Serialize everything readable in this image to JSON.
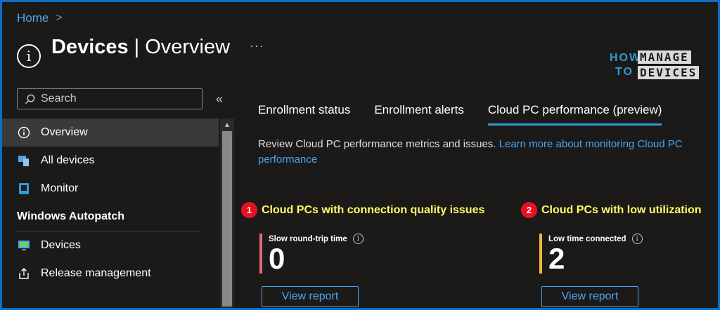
{
  "breadcrumb": {
    "home": "Home",
    "chevron": ">"
  },
  "header": {
    "title": "Devices",
    "separator": "|",
    "subtitle": "Overview",
    "more": "···",
    "icon": "info-circle-icon"
  },
  "logo": {
    "how": "HOW",
    "to": "TO",
    "manage": "MANAGE",
    "devices": "DEVICES"
  },
  "search": {
    "placeholder": "Search",
    "collapse": "«"
  },
  "sidebar": {
    "items": [
      {
        "label": "Overview",
        "icon": "info-circle-icon",
        "active": true
      },
      {
        "label": "All devices",
        "icon": "devices-icon"
      },
      {
        "label": "Monitor",
        "icon": "monitor-icon"
      }
    ],
    "section": "Windows Autopatch",
    "section_items": [
      {
        "label": "Devices",
        "icon": "desktop-icon"
      },
      {
        "label": "Release management",
        "icon": "upload-icon"
      }
    ]
  },
  "tabs": [
    {
      "label": "Enrollment status"
    },
    {
      "label": "Enrollment alerts"
    },
    {
      "label": "Cloud PC performance (preview)",
      "active": true
    }
  ],
  "description": {
    "text": "Review Cloud PC performance metrics and issues. ",
    "link": "Learn more about monitoring Cloud PC performance"
  },
  "cards": [
    {
      "badge": "1",
      "title": "Cloud PCs with connection quality issues",
      "metric_label": "Slow round-trip time",
      "value": "0",
      "bar_color": "#e06c75",
      "button": "View report"
    },
    {
      "badge": "2",
      "title": "Cloud PCs with low utilization",
      "metric_label": "Low time connected",
      "value": "2",
      "bar_color": "#f2b93b",
      "button": "View report"
    }
  ],
  "colors": {
    "accent": "#2f9ad8",
    "link": "#4aa3f0",
    "highlight": "#ffff66",
    "badge": "#e81123"
  }
}
